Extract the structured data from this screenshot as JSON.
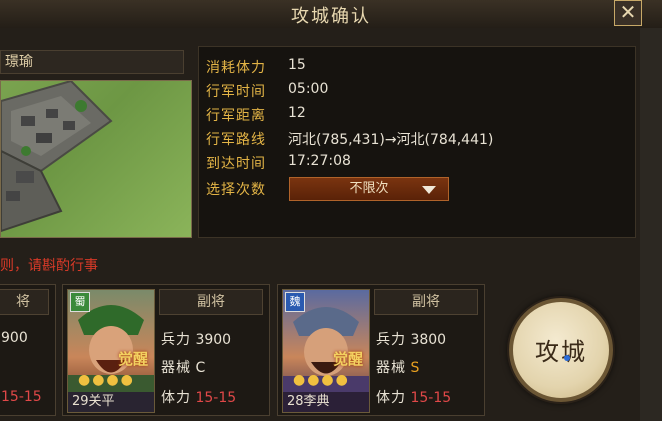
{
  "dialog": {
    "title": "攻城确认",
    "close_label": "✕"
  },
  "target": {
    "name": "璟瑜"
  },
  "info": {
    "rows": [
      {
        "label": "消耗体力",
        "value": "15"
      },
      {
        "label": "行军时间",
        "value": "05:00"
      },
      {
        "label": "行军距离",
        "value": "12"
      },
      {
        "label": "行军路线",
        "value": "河北(785,431)→河北(784,441)"
      },
      {
        "label": "到达时间",
        "value": "17:27:08"
      }
    ],
    "select": {
      "label": "选择次数",
      "value": "不限次"
    }
  },
  "warning": "则，请斟酌行事",
  "partial_card": {
    "role": "将",
    "troops": "900",
    "stamina": "15-15"
  },
  "generals": [
    {
      "faction": "蜀",
      "faction_color": "#3a8a3a",
      "level_name": "29关平",
      "awaken": "觉醒",
      "stars": "●●●●",
      "role": "副将",
      "troops_label": "兵力",
      "troops": "3900",
      "equip_label": "器械",
      "equip": "C",
      "stamina_label": "体力",
      "stamina": "15-15"
    },
    {
      "faction": "魏",
      "faction_color": "#2a5ab0",
      "level_name": "28李典",
      "awaken": "觉醒",
      "stars": "●●●●",
      "role": "副将",
      "troops_label": "兵力",
      "troops": "3800",
      "equip_label": "器械",
      "equip": "S",
      "stamina_label": "体力",
      "stamina": "15-15"
    }
  ],
  "attack_button": {
    "label": "攻城"
  },
  "colors": {
    "accent_gold": "#e3b446",
    "warning_red": "#d83a28",
    "stamina_red": "#e04848",
    "equip_s": "#e8a020"
  }
}
